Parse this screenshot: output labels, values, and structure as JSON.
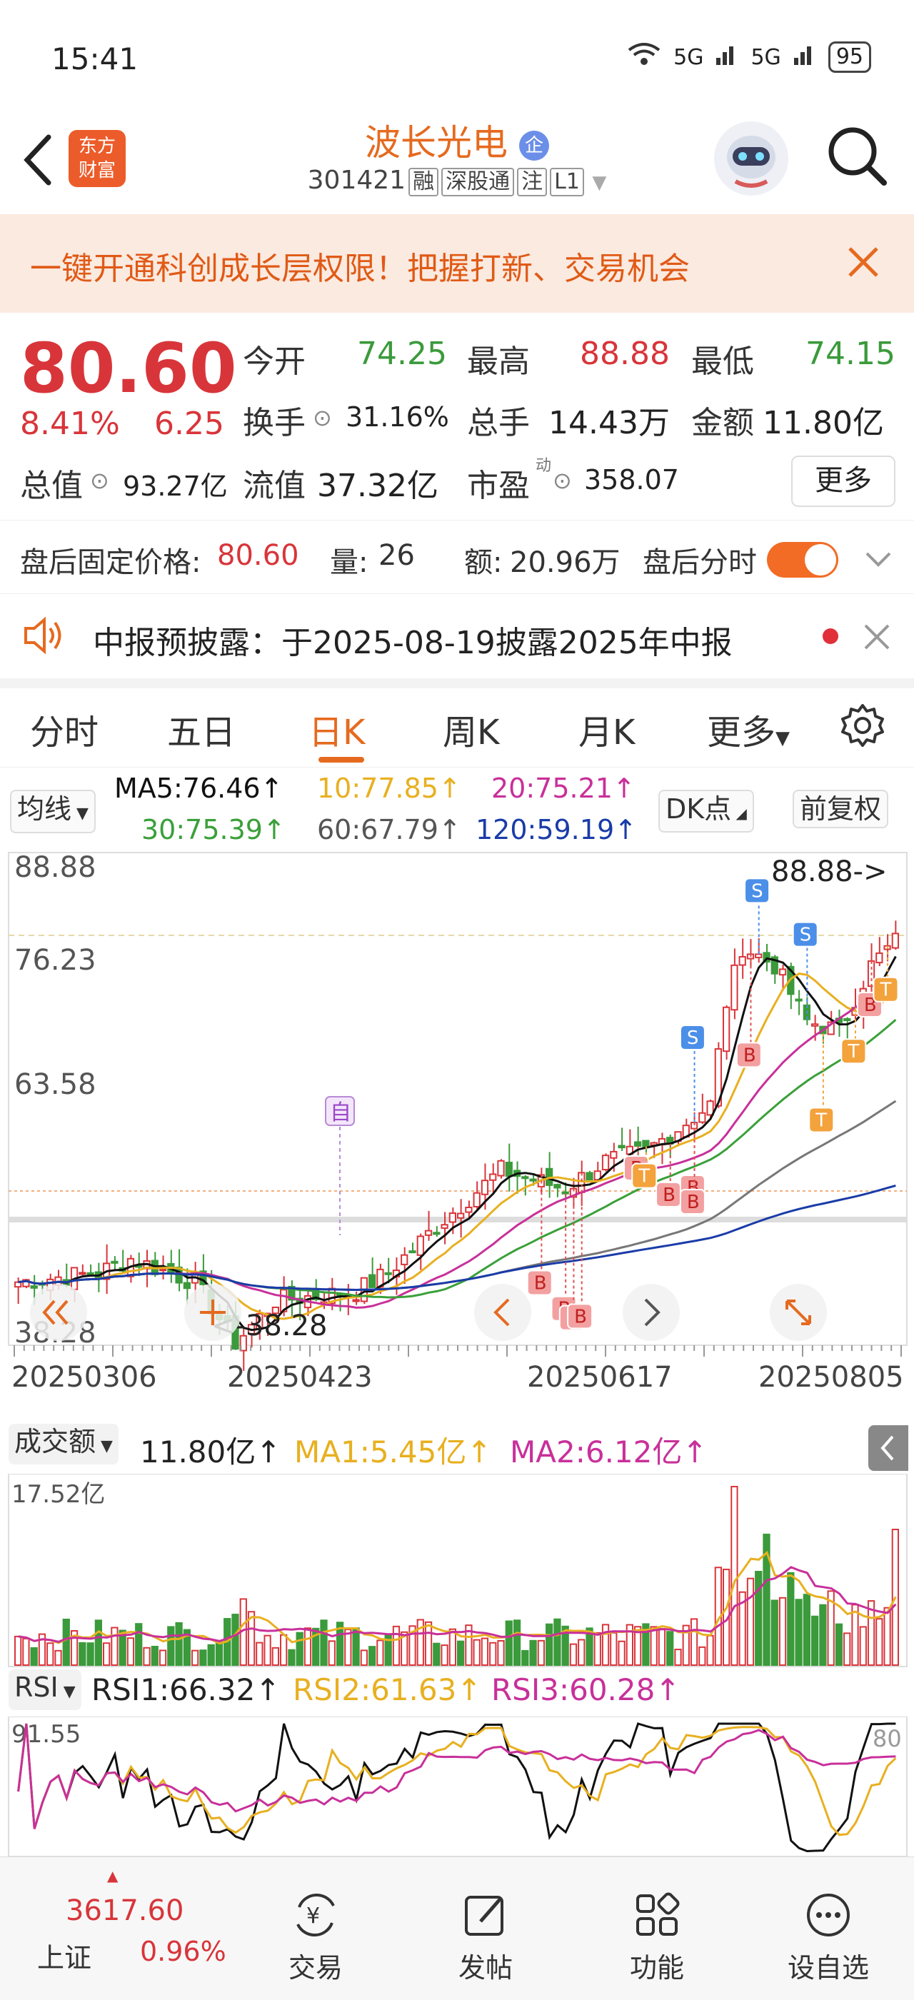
{
  "status": {
    "time": "15:41",
    "signal1": "5G",
    "signal2": "5G",
    "battery": "95"
  },
  "header": {
    "app_logo_line1": "东方",
    "app_logo_line2": "财富",
    "stock_name": "波长光电",
    "company_badge": "企",
    "stock_code": "301421",
    "tags": [
      "融",
      "深股通",
      "注",
      "L1"
    ]
  },
  "banner": {
    "text": "一键开通科创成长层权限！把握打新、交易机会"
  },
  "quote": {
    "price": "80.60",
    "change_pct": "8.41%",
    "change": "6.25",
    "open_label": "今开",
    "open": "74.25",
    "high_label": "最高",
    "high": "88.88",
    "low_label": "最低",
    "low": "74.15",
    "turnover_label": "换手",
    "turnover": "31.16%",
    "volume_label": "总手",
    "volume": "14.43万",
    "amount_label": "金额",
    "amount": "11.80亿",
    "mktcap_label": "总值",
    "mktcap": "93.27亿",
    "float_label": "流值",
    "float": "37.32亿",
    "pe_label": "市盈",
    "pe_sup": "动",
    "pe": "358.07",
    "more": "更多"
  },
  "afterhours": {
    "price_label": "盘后固定价格:",
    "price": "80.60",
    "vol_label": "量:",
    "vol": "26",
    "amt_label": "额:",
    "amt": "20.96万",
    "timeshare_label": "盘后分时"
  },
  "notice": {
    "text": "中报预披露：于2025-08-19披露2025年中报"
  },
  "tabs": [
    "分时",
    "五日",
    "日K",
    "周K",
    "月K",
    "更多"
  ],
  "active_tab": "日K",
  "ma_row": {
    "selector": "均线",
    "ma5": "MA5:76.46↑",
    "ma10": "10:77.85↑",
    "ma20": "20:75.21↑",
    "ma30": "30:75.39↑",
    "ma60": "60:67.79↑",
    "ma120": "120:59.19↑",
    "dk": "DK点",
    "adjust": "前复权"
  },
  "kline": {
    "y_top": "88.88",
    "y_mid1": "76.23",
    "y_mid2": "63.58",
    "y_bottom": "38.28",
    "max_label": "88.88->",
    "min_label": "<-38.28",
    "dates": [
      "20250306",
      "20250423",
      "20250617",
      "20250805"
    ],
    "marker_self": "自"
  },
  "volume_panel": {
    "selector": "成交额",
    "value": "11.80亿↑",
    "ma1": "MA1:5.45亿↑",
    "ma2": "MA2:6.12亿↑",
    "max_label": "17.52亿"
  },
  "rsi_panel": {
    "selector": "RSI",
    "rsi1": "RSI1:66.32↑",
    "rsi2": "RSI2:61.63↑",
    "rsi3": "RSI3:60.28↑",
    "top_label": "91.55",
    "line_80": "80"
  },
  "bottombar": {
    "index_value": "3617.60",
    "index_name": "上证",
    "index_change": "0.96%",
    "items": [
      "交易",
      "发帖",
      "功能",
      "设自选"
    ]
  },
  "colors": {
    "up": "#d8353a",
    "down": "#3b9a3b",
    "accent": "#e56a1f",
    "ma5": "#111111",
    "ma10": "#e8b020",
    "ma20": "#c8309a",
    "ma30": "#3aa03a",
    "ma60": "#777777",
    "ma120": "#1a3ca8"
  }
}
